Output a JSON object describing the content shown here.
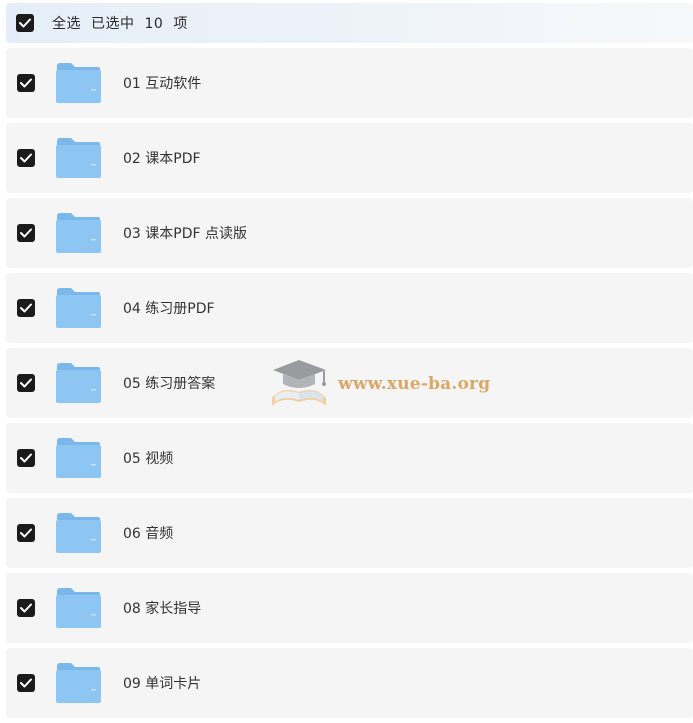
{
  "header": {
    "select_all_label": "全选",
    "selected_prefix": "已选中",
    "selected_count": "10",
    "selected_suffix": "项"
  },
  "items": [
    {
      "label": "01 互动软件",
      "checked": true,
      "icon": "folder-icon"
    },
    {
      "label": "02 课本PDF",
      "checked": true,
      "icon": "folder-icon"
    },
    {
      "label": "03 课本PDF 点读版",
      "checked": true,
      "icon": "folder-icon"
    },
    {
      "label": "04 练习册PDF",
      "checked": true,
      "icon": "folder-icon"
    },
    {
      "label": "05 练习册答案",
      "checked": true,
      "icon": "folder-icon"
    },
    {
      "label": "05 视频",
      "checked": true,
      "icon": "folder-icon"
    },
    {
      "label": "06 音频",
      "checked": true,
      "icon": "folder-icon"
    },
    {
      "label": "08 家长指导",
      "checked": true,
      "icon": "folder-icon"
    },
    {
      "label": "09 单词卡片",
      "checked": true,
      "icon": "folder-icon"
    }
  ],
  "watermark": {
    "text": "www.xue-ba.org"
  },
  "colors": {
    "checkbox": "#1b1b1b",
    "row_background": "#f5f5f6",
    "folder": "#8ec6f3",
    "watermark": "#d79a4d"
  }
}
